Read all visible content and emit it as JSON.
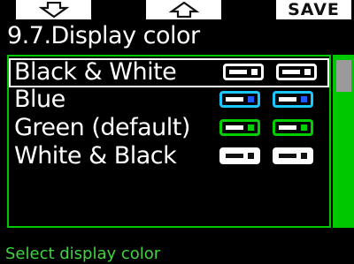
{
  "topbar": {
    "down_icon": "arrow-down-icon",
    "up_icon": "arrow-up-icon",
    "save_label": "SAVE"
  },
  "title": "9.7.Display color",
  "options": [
    {
      "label": "Black & White",
      "color": "#ffffff",
      "icon_fill": "#ffffff",
      "selected": true
    },
    {
      "label": "Blue",
      "color": "#ffffff",
      "icon_fill": "#1e90ff",
      "selected": false
    },
    {
      "label": "Green (default)",
      "color": "#ffffff",
      "icon_fill": "#00d000",
      "selected": false
    },
    {
      "label": "White & Black",
      "color": "#ffffff",
      "icon_fill": "#ffffff",
      "selected": false
    }
  ],
  "status": "Select display color",
  "colors": {
    "accent": "#00c800",
    "status_text": "#3fd33f",
    "background": "#000000"
  }
}
